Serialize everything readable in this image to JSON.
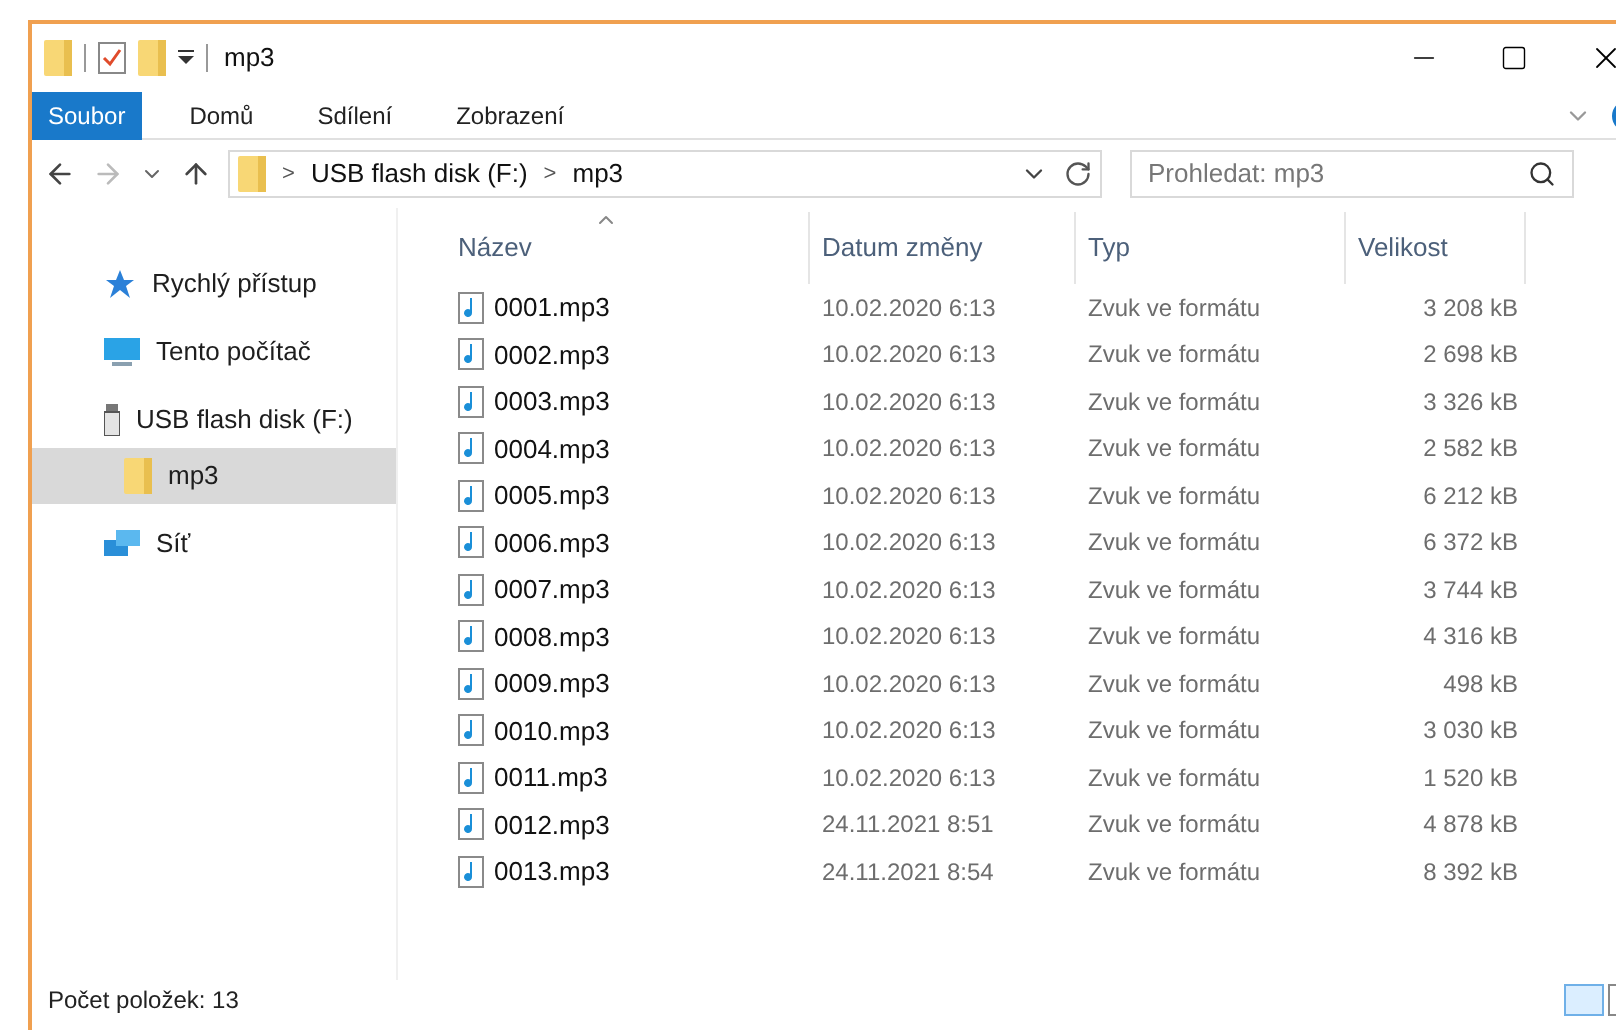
{
  "window": {
    "title": "mp3"
  },
  "ribbon_tabs": [
    {
      "label": "Soubor",
      "selected": true
    },
    {
      "label": "Domů",
      "selected": false
    },
    {
      "label": "Sdílení",
      "selected": false
    },
    {
      "label": "Zobrazení",
      "selected": false
    }
  ],
  "address_bar": {
    "path": [
      "USB flash disk (F:)",
      "mp3"
    ],
    "separator": ">"
  },
  "search": {
    "placeholder": "Prohledat: mp3"
  },
  "sidebar": {
    "items": [
      {
        "label": "Rychlý přístup",
        "kind": "star",
        "selected": false
      },
      {
        "label": "Tento počítač",
        "kind": "computer",
        "selected": false
      },
      {
        "label": "USB flash disk (F:)",
        "kind": "usb",
        "selected": false,
        "children": [
          {
            "label": "mp3",
            "kind": "folder",
            "selected": true
          }
        ]
      },
      {
        "label": "Síť",
        "kind": "network",
        "selected": false
      }
    ]
  },
  "table": {
    "columns": [
      "Název",
      "Datum změny",
      "Typ",
      "Velikost"
    ],
    "rows": [
      [
        "0001.mp3",
        "10.02.2020 6:13",
        "Zvuk ve formátu",
        "3 208 kB"
      ],
      [
        "0002.mp3",
        "10.02.2020 6:13",
        "Zvuk ve formátu",
        "2 698 kB"
      ],
      [
        "0003.mp3",
        "10.02.2020 6:13",
        "Zvuk ve formátu",
        "3 326 kB"
      ],
      [
        "0004.mp3",
        "10.02.2020 6:13",
        "Zvuk ve formátu",
        "2 582 kB"
      ],
      [
        "0005.mp3",
        "10.02.2020 6:13",
        "Zvuk ve formátu",
        "6 212 kB"
      ],
      [
        "0006.mp3",
        "10.02.2020 6:13",
        "Zvuk ve formátu",
        "6 372 kB"
      ],
      [
        "0007.mp3",
        "10.02.2020 6:13",
        "Zvuk ve formátu",
        "3 744 kB"
      ],
      [
        "0008.mp3",
        "10.02.2020 6:13",
        "Zvuk ve formátu",
        "4 316 kB"
      ],
      [
        "0009.mp3",
        "10.02.2020 6:13",
        "Zvuk ve formátu",
        "498 kB"
      ],
      [
        "0010.mp3",
        "10.02.2020 6:13",
        "Zvuk ve formátu",
        "3 030 kB"
      ],
      [
        "0011.mp3",
        "10.02.2020 6:13",
        "Zvuk ve formátu",
        "1 520 kB"
      ],
      [
        "0012.mp3",
        "24.11.2021 8:51",
        "Zvuk ve formátu",
        "4 878 kB"
      ],
      [
        "0013.mp3",
        "24.11.2021 8:54",
        "Zvuk ve formátu",
        "8 392 kB"
      ]
    ]
  },
  "status_bar": {
    "text": "Počet položek: 13"
  }
}
